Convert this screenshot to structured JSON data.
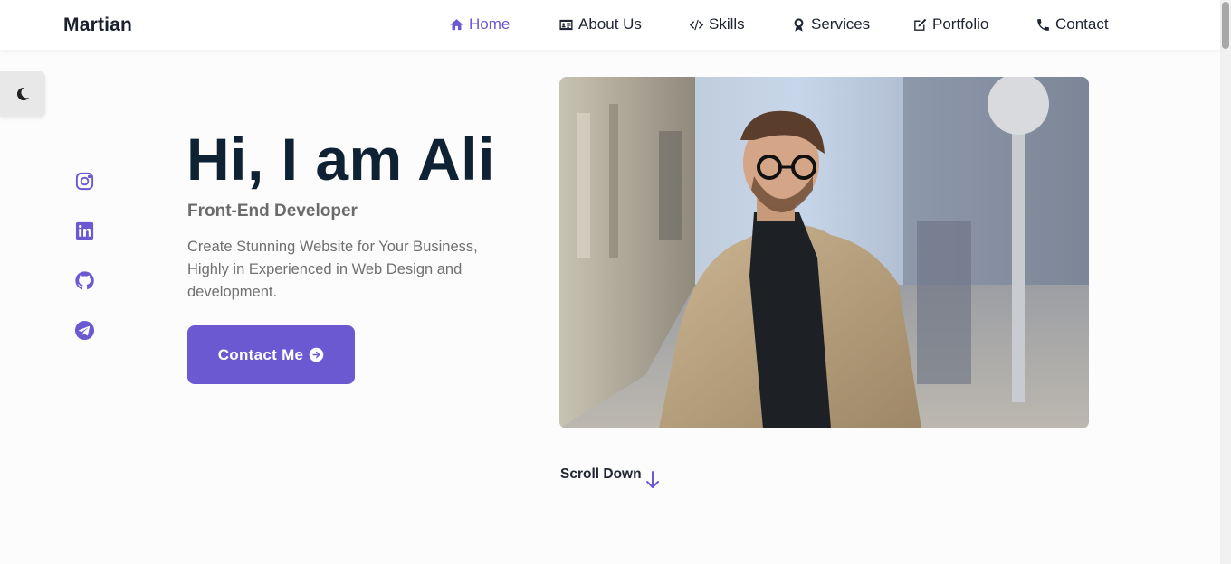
{
  "header": {
    "logo": "Martian",
    "nav": [
      {
        "label": "Home",
        "icon": "home-icon",
        "active": true
      },
      {
        "label": "About Us",
        "icon": "id-card-icon",
        "active": false
      },
      {
        "label": "Skills",
        "icon": "code-icon",
        "active": false
      },
      {
        "label": "Services",
        "icon": "award-icon",
        "active": false
      },
      {
        "label": "Portfolio",
        "icon": "edit-icon",
        "active": false
      },
      {
        "label": "Contact",
        "icon": "phone-icon",
        "active": false
      }
    ]
  },
  "theme_toggle": {
    "icon": "moon-icon"
  },
  "socials": [
    {
      "icon": "instagram-icon"
    },
    {
      "icon": "linkedin-icon"
    },
    {
      "icon": "github-icon"
    },
    {
      "icon": "telegram-icon"
    }
  ],
  "hero": {
    "title": "Hi, I am Ali",
    "subtitle": "Front-End Developer",
    "description": "Create Stunning Website for Your Business, Highly in Experienced in Web Design and development.",
    "cta_label": "Contact Me",
    "cta_icon": "arrow-circle-right-icon",
    "photo_icon": "profile-photo"
  },
  "scroll_down": {
    "label": "Scroll Down",
    "icon": "arrow-down-icon"
  },
  "colors": {
    "accent": "#6a59d1",
    "text_dark": "#0f2233",
    "text_muted": "#707070",
    "background": "#fcfcfc"
  }
}
